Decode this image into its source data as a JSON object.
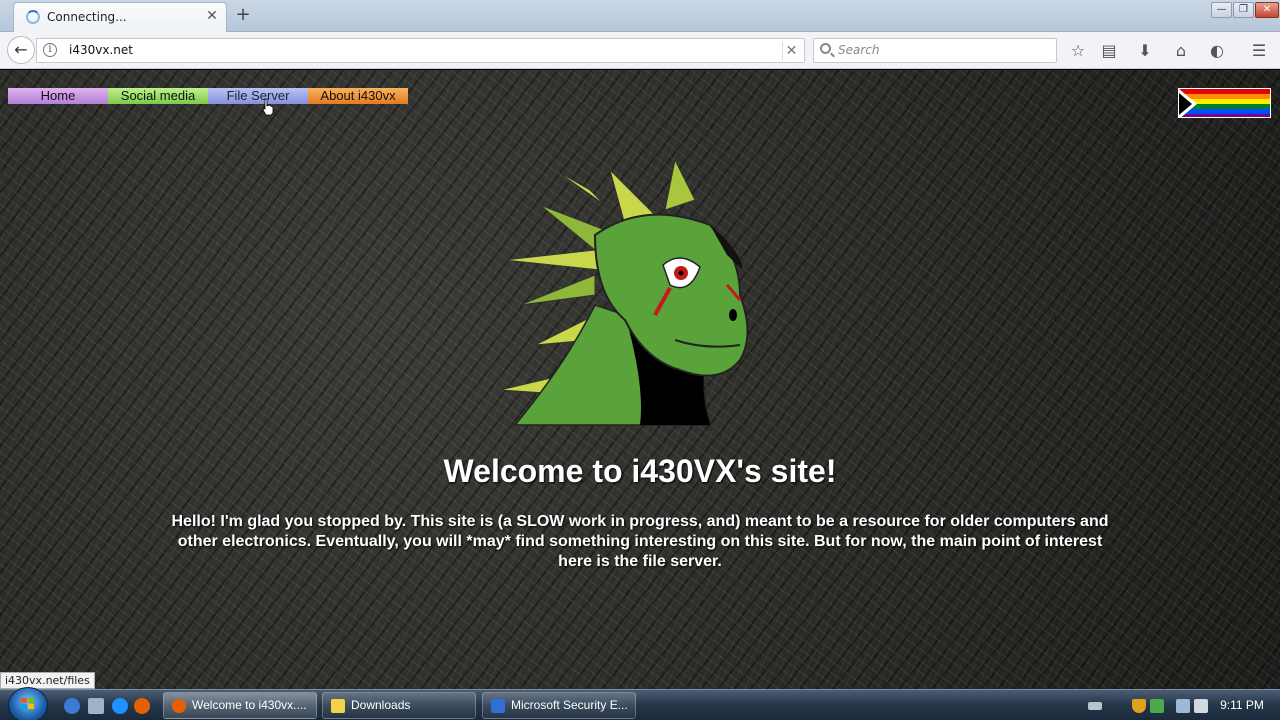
{
  "browser": {
    "tab": {
      "title": "Connecting...",
      "close_label": "✕"
    },
    "new_tab_label": "+",
    "window_controls": {
      "minimize": "—",
      "maximize": "❐",
      "close": "✕"
    },
    "nav": {
      "back_label": "←",
      "info_label": "i",
      "url": "i430vx.net",
      "stop_label": "✕",
      "search_placeholder": "Search"
    },
    "toolbar_icons": [
      "star-icon",
      "reader-icon",
      "download-icon",
      "home-icon",
      "pocket-icon",
      "menu-icon"
    ],
    "toolbar_glyphs": {
      "star": "☆",
      "reader": "▤",
      "download": "⬇",
      "home": "⌂",
      "pocket": "◐",
      "menu": "☰"
    }
  },
  "page": {
    "menu": [
      {
        "label": "Home",
        "color": "#c99ae4"
      },
      {
        "label": "Social media",
        "color": "#9ddf6a"
      },
      {
        "label": "File Server",
        "color": "#9ea9ea"
      },
      {
        "label": "About i430vx",
        "color": "#ee9840"
      }
    ],
    "heading": "Welcome to i430VX's site!",
    "intro": "Hello! I'm glad you stopped by. This site is (a SLOW work in progress, and) meant to be a resource for older computers and other electronics. Eventually, you will *may* find something interesting on this site. But for now, the main point of interest here is the file server.",
    "flag_colors": [
      "#e40303",
      "#ff8c00",
      "#ffed00",
      "#008026",
      "#004dff",
      "#750787"
    ]
  },
  "status_url": "i430vx.net/files",
  "taskbar": {
    "tasks": [
      {
        "label": "Welcome to i430vx....",
        "icon_color": "#e66000"
      },
      {
        "label": "Downloads",
        "icon_color": "#f3d24a"
      },
      {
        "label": "Microsoft Security E...",
        "icon_color": "#2f6fd6"
      }
    ],
    "clock": "9:11 PM"
  }
}
